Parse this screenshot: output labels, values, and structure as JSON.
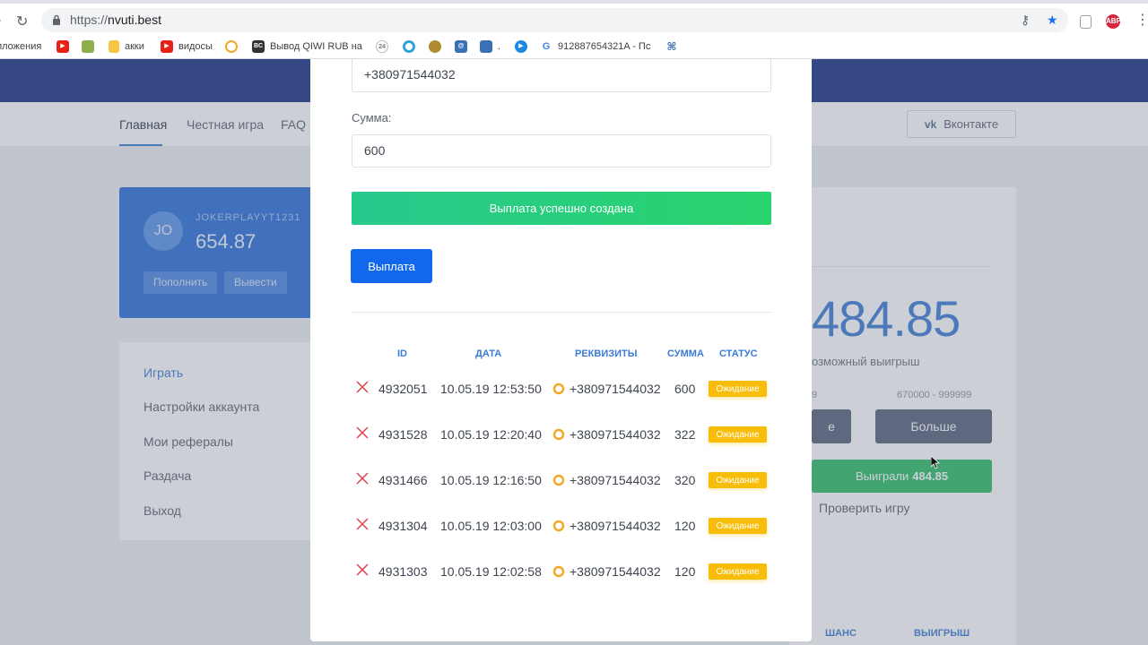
{
  "browser": {
    "url_protocol": "https://",
    "url_host": "nvuti.best",
    "bookmarks": [
      {
        "label": "иложения",
        "icon": "apps-grid-icon",
        "color": ""
      },
      {
        "label": "",
        "icon": "youtube-icon",
        "color": "#e62117"
      },
      {
        "label": "",
        "icon": "picture-icon",
        "color": "#8fae4c"
      },
      {
        "label": "акки",
        "icon": "folder-icon",
        "color": "#f6c644"
      },
      {
        "label": "видосы",
        "icon": "youtube-icon",
        "color": "#e62117"
      },
      {
        "label": "",
        "icon": "qiwi-icon",
        "color": "#f5a623"
      },
      {
        "label": "Вывод QIWI RUB на",
        "icon": "exchange-icon",
        "color": "#333333"
      },
      {
        "label": "",
        "icon": "24-icon",
        "color": "#9a9a9a"
      },
      {
        "label": "",
        "icon": "circle-icon",
        "color": "#2fa7d8"
      },
      {
        "label": "",
        "icon": "owl-icon",
        "color": "#b08a2e"
      },
      {
        "label": "",
        "icon": "mail-icon",
        "color": "#3b6fb6"
      },
      {
        "label": ".",
        "icon": "chat-icon",
        "color": "#3b6fb6"
      },
      {
        "label": "",
        "icon": "play-icon",
        "color": "#1e88e5"
      },
      {
        "label": "912887654321A - Пс",
        "icon": "google-icon",
        "color": "#4285f4"
      },
      {
        "label": "",
        "icon": "puzzle-icon",
        "color": "#3b6fb6"
      }
    ]
  },
  "site": {
    "nav": [
      "Главная",
      "Честная игра",
      "FAQ"
    ],
    "vk_label": "Вконтакте",
    "vk_logo": "vk",
    "profile": {
      "avatar": "JO",
      "username": "JOKERPLAYYT1231",
      "balance": "654.87",
      "deposit": "Пополнить",
      "withdraw": "Вывести"
    },
    "menu": [
      "Играть",
      "Настройки аккаунта",
      "Мои рефералы",
      "Раздача",
      "Выход"
    ],
    "game": {
      "big_number": "484.85",
      "possible_label": "озможный выигрыш",
      "range_left": "9",
      "range_right": "670000 - 999999",
      "less_partial": "е",
      "more_label": "Больше",
      "won_label": "Выиграли",
      "won_value": "484.85",
      "check_game": "Проверить игру",
      "col_chance": "ШАНС",
      "col_win": "ВЫИГРЫШ"
    }
  },
  "modal": {
    "phone_value": "+380971544032",
    "amount_label": "Сумма:",
    "amount_value": "600",
    "success_text": "Выплата успешно создана",
    "payout_button": "Выплата",
    "columns": {
      "id": "ID",
      "date": "ДАТА",
      "requisites": "РЕКВИЗИТЫ",
      "sum": "СУММА",
      "status": "СТАТУС"
    },
    "rows": [
      {
        "id": "4932051",
        "date": "10.05.19 12:53:50",
        "req": "+380971544032",
        "sum": "600",
        "status": "Ожидание"
      },
      {
        "id": "4931528",
        "date": "10.05.19 12:20:40",
        "req": "+380971544032",
        "sum": "322",
        "status": "Ожидание"
      },
      {
        "id": "4931466",
        "date": "10.05.19 12:16:50",
        "req": "+380971544032",
        "sum": "320",
        "status": "Ожидание"
      },
      {
        "id": "4931304",
        "date": "10.05.19 12:03:00",
        "req": "+380971544032",
        "sum": "120",
        "status": "Ожидание"
      },
      {
        "id": "4931303",
        "date": "10.05.19 12:02:58",
        "req": "+380971544032",
        "sum": "120",
        "status": "Ожидание"
      }
    ]
  }
}
